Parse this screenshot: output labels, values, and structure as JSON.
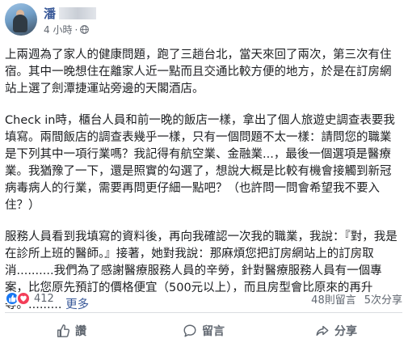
{
  "post": {
    "author_name": "潘",
    "timestamp": "4 小時",
    "privacy_icon": "globe-icon",
    "paragraphs": [
      "上兩週為了家人的健康問題，跑了三趟台北，當天來回了兩次，第三次有住宿。其中一晚想住在離家人近一點而且交通比較方便的地方，於是在訂房網站上選了劍潭捷運站旁邊的天閣酒店。",
      "Check in時，櫃台人員和前一晚的飯店一樣，拿出了個人旅遊史調查表要我填寫。兩間飯店的調查表幾乎一樣，只有一個問題不太一樣：請問您的職業是下列其中一項行業嗎？我記得有航空業、金融業...，最後一個選項是醫療業。我猶豫了一下，還是照實的勾選了，想說大概是比較有機會接觸到新冠病毒病人的行業，需要再問更仔細一點吧？（也許問一問會希望我不要入住？）",
      "服務人員看到我填寫的資料後，再向我確認一次我的職業，我說：『對，我是在診所上班的醫師。』接著，她對我說：那麻煩您把訂房網站上的訂房取消..........我們為了感謝醫療服務人員的辛勞，針對醫療服務人員有一個專案，比您原先預訂的價格便宜（500元以上），而且房型會比原來的再升等。.........",
      "更多"
    ]
  },
  "stats": {
    "reaction_count": "412",
    "comments": "48則留言",
    "shares": "5次分享"
  },
  "actions": {
    "like": "讚",
    "comment": "留言",
    "share": "分享"
  },
  "colors": {
    "link": "#385898",
    "like_blue": "#1877f2",
    "heart_red": "#f33e58",
    "muted": "#606770"
  }
}
